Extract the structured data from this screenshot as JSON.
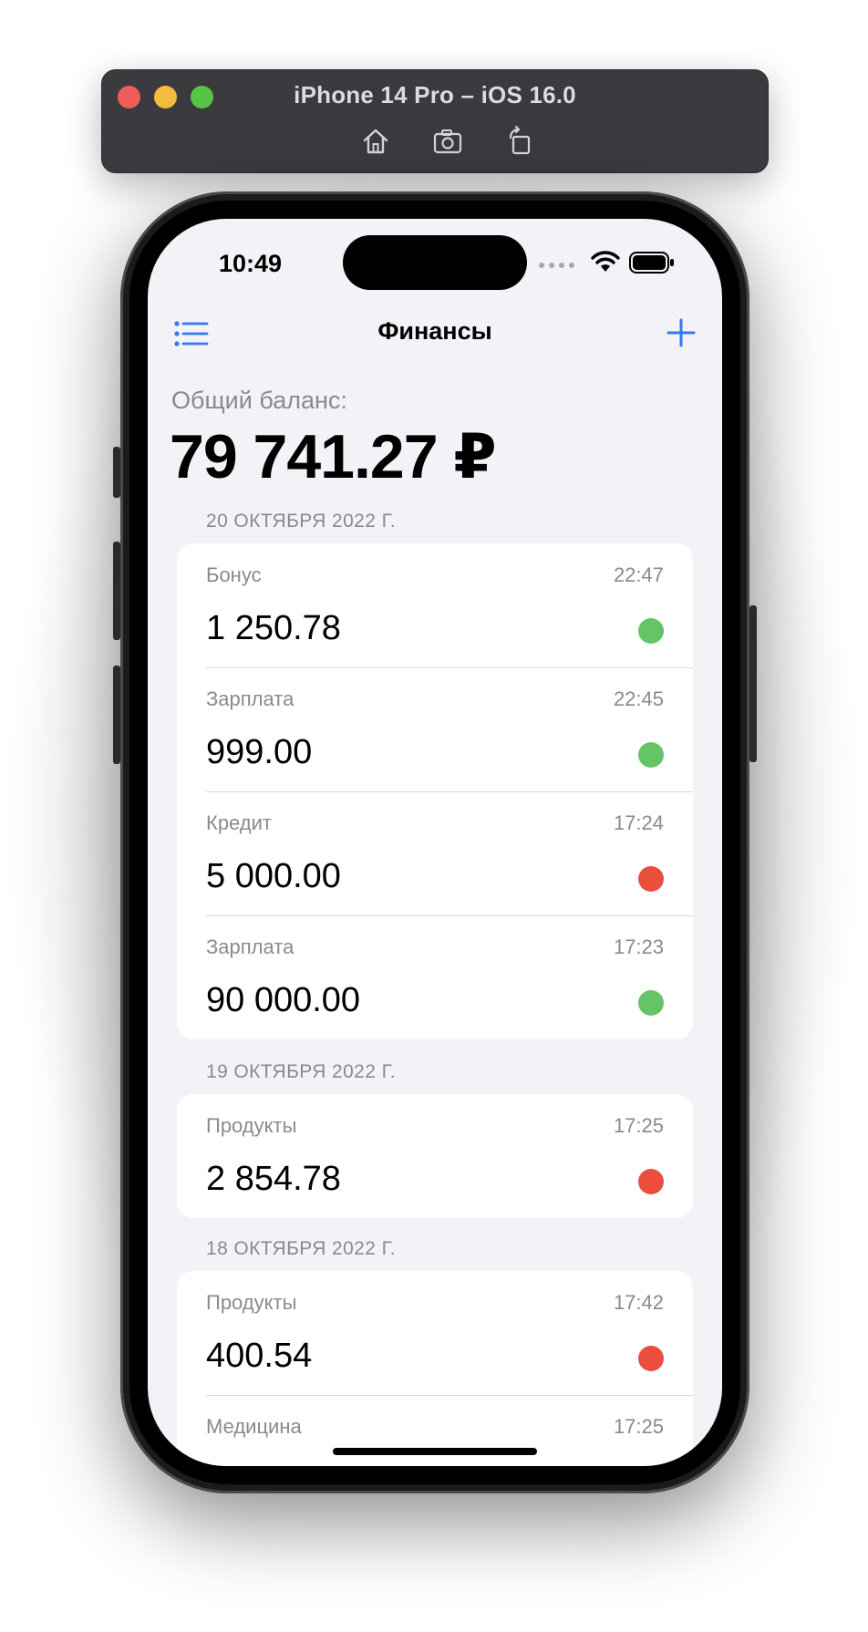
{
  "simulator": {
    "title": "iPhone 14 Pro – iOS 16.0",
    "tools": [
      "home-icon",
      "screenshot-icon",
      "rotate-icon"
    ]
  },
  "status_bar": {
    "time": "10:49"
  },
  "nav": {
    "title": "Финансы",
    "menu_icon": "list-icon",
    "add_icon": "plus-icon"
  },
  "balance": {
    "label": "Общий баланс:",
    "value": "79 741.27 ₽"
  },
  "colors": {
    "income": "#65c466",
    "expense": "#eb4e3d",
    "accent": "#3478f6"
  },
  "sections": [
    {
      "date": "20 ОКТЯБРЯ 2022 Г.",
      "items": [
        {
          "category": "Бонус",
          "time": "22:47",
          "amount": "1 250.78",
          "type": "income"
        },
        {
          "category": "Зарплата",
          "time": "22:45",
          "amount": "999.00",
          "type": "income"
        },
        {
          "category": "Кредит",
          "time": "17:24",
          "amount": "5 000.00",
          "type": "expense"
        },
        {
          "category": "Зарплата",
          "time": "17:23",
          "amount": "90 000.00",
          "type": "income"
        }
      ]
    },
    {
      "date": "19 ОКТЯБРЯ 2022 Г.",
      "items": [
        {
          "category": "Продукты",
          "time": "17:25",
          "amount": "2 854.78",
          "type": "expense"
        }
      ]
    },
    {
      "date": "18 ОКТЯБРЯ 2022 Г.",
      "items": [
        {
          "category": "Продукты",
          "time": "17:42",
          "amount": "400.54",
          "type": "expense"
        },
        {
          "category": "Медицина",
          "time": "17:25",
          "amount": "",
          "type": ""
        }
      ]
    }
  ]
}
